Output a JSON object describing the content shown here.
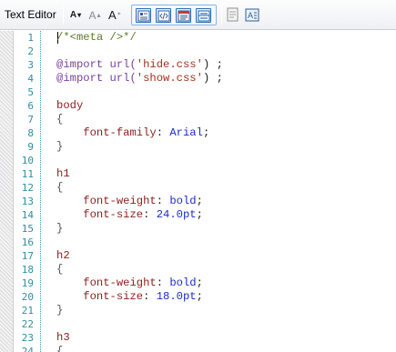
{
  "toolbar": {
    "title": "Text Editor",
    "font_decrease": {
      "label": "A",
      "icon": "font-decrease-icon"
    },
    "font_increase": {
      "label": "A",
      "icon": "font-increase-icon"
    },
    "font_standard": {
      "label": "A",
      "icon": "font-standard-icon"
    },
    "mode_buttons": [
      "design-view-icon",
      "source-view-icon",
      "preview-icon",
      "split-view-icon"
    ],
    "extra_buttons": [
      "notes-icon",
      "text-format-icon"
    ]
  },
  "colors": {
    "line_number": "#2e8fa0",
    "selector": "#8b1d1d",
    "property": "#8b1d1d",
    "value": "#1c2ccc",
    "keyword": "#7a3fa0",
    "string": "#a0301f",
    "comment": "#5b7a2a"
  },
  "editor": {
    "line_numbers": [
      "1",
      "2",
      "3",
      "4",
      "5",
      "6",
      "7",
      "8",
      "9",
      "10",
      "11",
      "12",
      "13",
      "14",
      "15",
      "16",
      "17",
      "18",
      "19",
      "20",
      "21",
      "22",
      "23",
      "24"
    ],
    "lines": {
      "l1_comment": "/*<meta />*/",
      "l3_kw": "@import",
      "l3_url": "url(",
      "l3_str": "'hide.css'",
      "l3_end": ") ;",
      "l4_kw": "@import",
      "l4_url": "url(",
      "l4_str": "'show.css'",
      "l4_end": ") ;",
      "l6_sel": "body",
      "l7": "{",
      "l8_prop": "font-family",
      "l8_colon": ": ",
      "l8_val": "Arial",
      "l8_end": ";",
      "l9": "}",
      "l11_sel": "h1",
      "l12": "{",
      "l13_prop": "font-weight",
      "l13_colon": ": ",
      "l13_val": "bold",
      "l13_end": ";",
      "l14_prop": "font-size",
      "l14_colon": ": ",
      "l14_val": "24.0pt",
      "l14_end": ";",
      "l15": "}",
      "l17_sel": "h2",
      "l18": "{",
      "l19_prop": "font-weight",
      "l19_colon": ": ",
      "l19_val": "bold",
      "l19_end": ";",
      "l20_prop": "font-size",
      "l20_colon": ": ",
      "l20_val": "18.0pt",
      "l20_end": ";",
      "l21": "}",
      "l23_sel": "h3",
      "l24": "{"
    }
  }
}
